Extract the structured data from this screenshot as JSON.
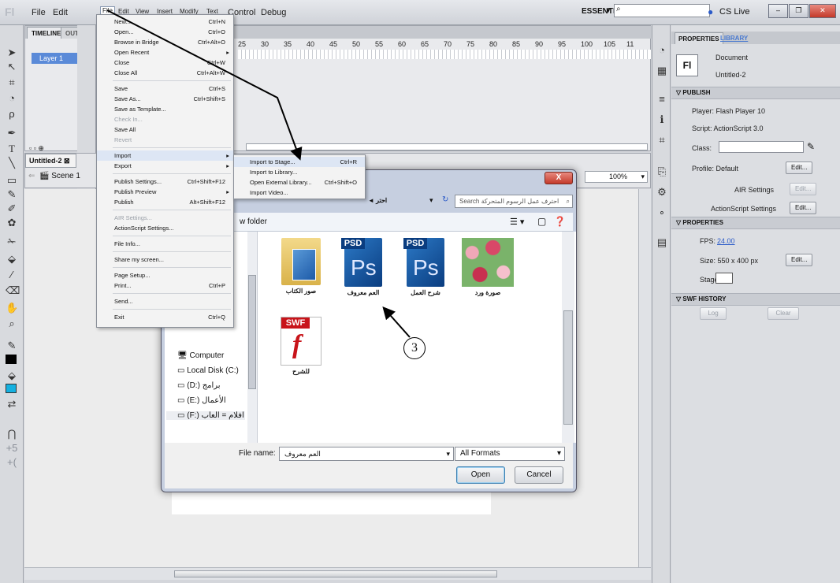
{
  "app": {
    "logo": "Fl",
    "menu": [
      "File",
      "Edit",
      "View",
      "Insert",
      "Modify",
      "Text",
      "Control",
      "Debug"
    ],
    "workspace": "ESSENTIALS",
    "cs_live": "CS Live",
    "window_buttons": [
      "–",
      "❐",
      "✕"
    ]
  },
  "timeline": {
    "tabs": [
      "TIMELINE",
      "OUTP"
    ],
    "layer": "Layer 1",
    "ruler": [
      "25",
      "30",
      "35",
      "40",
      "45",
      "50",
      "55",
      "60",
      "65",
      "70",
      "75",
      "80",
      "85",
      "90",
      "95",
      "100",
      "105",
      "11"
    ]
  },
  "scene": {
    "tab": "Untitled-2",
    "label": "Scene 1",
    "zoom": "100%"
  },
  "file_menu": [
    {
      "label": "New...",
      "shortcut": "Ctrl+N"
    },
    {
      "label": "Open...",
      "shortcut": "Ctrl+O"
    },
    {
      "label": "Browse in Bridge",
      "shortcut": "Ctrl+Alt+O"
    },
    {
      "label": "Open Recent",
      "shortcut": "",
      "submenu": true
    },
    {
      "label": "Close",
      "shortcut": "Ctrl+W"
    },
    {
      "label": "Close All",
      "shortcut": "Ctrl+Alt+W"
    },
    {
      "sep": true
    },
    {
      "label": "Save",
      "shortcut": "Ctrl+S"
    },
    {
      "label": "Save As...",
      "shortcut": "Ctrl+Shift+S"
    },
    {
      "label": "Save as Template...",
      "shortcut": ""
    },
    {
      "label": "Check In...",
      "shortcut": "",
      "disabled": true
    },
    {
      "label": "Save All",
      "shortcut": ""
    },
    {
      "label": "Revert",
      "shortcut": "",
      "disabled": true
    },
    {
      "sep": true
    },
    {
      "label": "Import",
      "shortcut": "",
      "submenu": true,
      "highlight": true
    },
    {
      "label": "Export",
      "shortcut": "",
      "submenu": true
    },
    {
      "sep": true
    },
    {
      "label": "Publish Settings...",
      "shortcut": "Ctrl+Shift+F12"
    },
    {
      "label": "Publish Preview",
      "shortcut": "",
      "submenu": true
    },
    {
      "label": "Publish",
      "shortcut": "Alt+Shift+F12"
    },
    {
      "sep": true
    },
    {
      "label": "AIR Settings...",
      "shortcut": "",
      "disabled": true
    },
    {
      "label": "ActionScript Settings...",
      "shortcut": ""
    },
    {
      "sep": true
    },
    {
      "label": "File Info...",
      "shortcut": ""
    },
    {
      "sep": true
    },
    {
      "label": "Share my screen...",
      "shortcut": ""
    },
    {
      "sep": true
    },
    {
      "label": "Page Setup...",
      "shortcut": ""
    },
    {
      "label": "Print...",
      "shortcut": "Ctrl+P"
    },
    {
      "sep": true
    },
    {
      "label": "Send...",
      "shortcut": ""
    },
    {
      "sep": true
    },
    {
      "label": "Exit",
      "shortcut": "Ctrl+Q"
    }
  ],
  "import_submenu": [
    {
      "label": "Import to Stage...",
      "shortcut": "Ctrl+R"
    },
    {
      "label": "Import to Library...",
      "shortcut": ""
    },
    {
      "label": "Open External Library...",
      "shortcut": "Ctrl+Shift+O"
    },
    {
      "label": "Import Video...",
      "shortcut": ""
    }
  ],
  "dialog": {
    "close": "X",
    "address_arrow": "◄ احتر",
    "search_placeholder": "Search احترف عمل الرسوم المتحركة",
    "new_folder": "w folder",
    "nav": [
      {
        "label": "Computer",
        "icon": "computer-icon"
      },
      {
        "label": "Local Disk (C:)",
        "icon": "disk-icon"
      },
      {
        "label": "(D:) برامج",
        "icon": "disk-icon"
      },
      {
        "label": "(E:) الأعمال",
        "icon": "disk-icon"
      },
      {
        "label": "(F:) افلام = العاب",
        "icon": "disk-icon"
      }
    ],
    "files": [
      {
        "label": "صور الكتاب",
        "kind": "folder"
      },
      {
        "label": "العم معروف",
        "kind": "psd"
      },
      {
        "label": "شرح العمل",
        "kind": "psd"
      },
      {
        "label": "صورة ورد",
        "kind": "image"
      },
      {
        "label": "للشرح",
        "kind": "swf"
      }
    ],
    "psd_tag": "PSD",
    "ps_text": "Ps",
    "swf_tag": "SWF",
    "callout": "3",
    "file_name_label": "File name:",
    "file_name_value": "العم معروف",
    "file_type": "All Formats",
    "open": "Open",
    "cancel": "Cancel"
  },
  "properties": {
    "tabs": [
      "PROPERTIES",
      "LIBRARY"
    ],
    "doc_badge": "Fl",
    "doc_type": "Document",
    "doc_name": "Untitled-2",
    "publish_header": "PUBLISH",
    "player": "Player:  Flash Player 10",
    "script": "Script:  ActionScript 3.0",
    "class_label": "Class:",
    "profile": "Profile:  Default",
    "edit": "Edit...",
    "air_settings": "AIR Settings",
    "as_settings": "ActionScript Settings",
    "props_header": "PROPERTIES",
    "fps_label": "FPS:",
    "fps_value": "24.00",
    "size": "Size:  550 x 400 px",
    "stage_label": "Stage:",
    "swf_header": "SWF HISTORY",
    "log": "Log",
    "clear": "Clear"
  }
}
